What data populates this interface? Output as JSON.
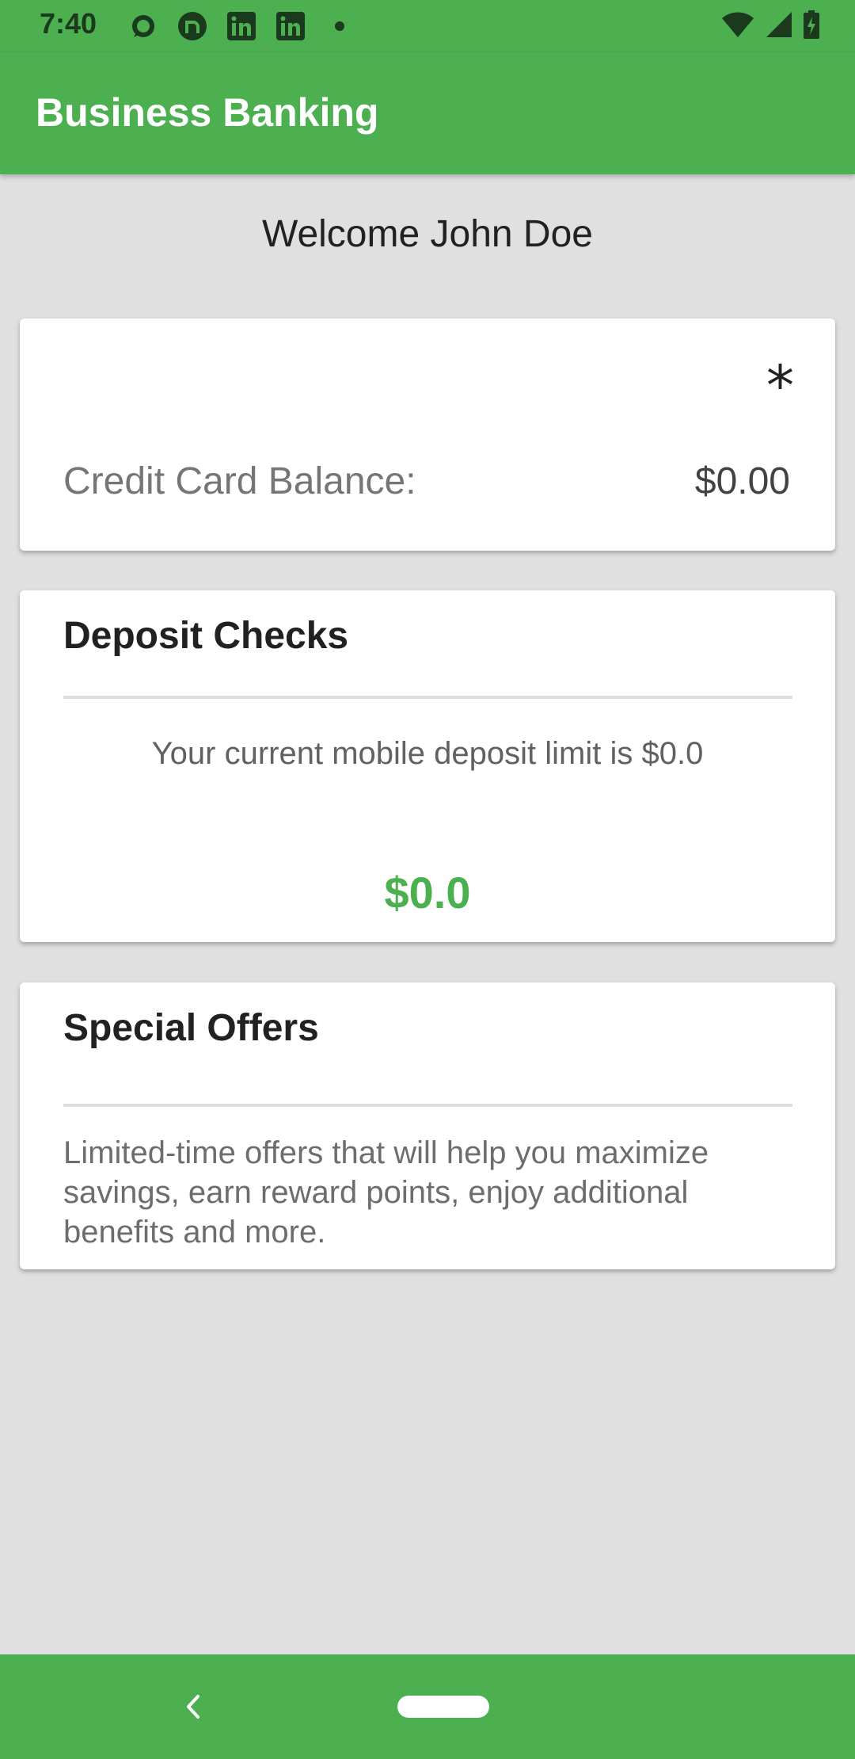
{
  "status_bar": {
    "time": "7:40",
    "notifications": [
      "signal-icon",
      "nextdoor-icon",
      "linkedin-icon",
      "linkedin-icon",
      "dot-icon"
    ],
    "system_icons": [
      "wifi-icon",
      "cell-signal-icon",
      "battery-icon"
    ]
  },
  "app_bar": {
    "title": "Business Banking"
  },
  "welcome": "Welcome John Doe",
  "balance_card": {
    "icon": "asterisk-icon",
    "label": "Credit Card Balance:",
    "value": "$0.00"
  },
  "deposit_card": {
    "title": "Deposit Checks",
    "limit_text": "Your current mobile deposit limit is $0.0",
    "amount": "$0.0"
  },
  "offers_card": {
    "title": "Special Offers",
    "description": "Limited-time offers that will help you maximize savings, earn reward points, enjoy additional benefits and more."
  },
  "nav_bar": {
    "icons": [
      "back-icon",
      "home-pill-icon"
    ]
  },
  "colors": {
    "primary": "#4caf50",
    "background": "#e0e0e0",
    "card": "#ffffff",
    "accent_amount": "#4caf50"
  }
}
